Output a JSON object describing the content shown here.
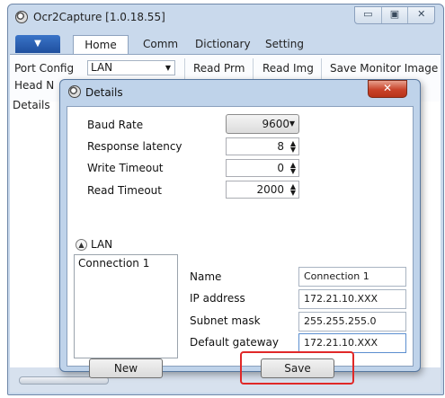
{
  "window": {
    "title": "Ocr2Capture [1.0.18.55]",
    "controls": [
      "▭",
      "▣",
      "✕"
    ]
  },
  "ribbon": {
    "tabs": [
      "Home",
      "Comm",
      "Dictionary",
      "Setting"
    ],
    "row1": {
      "port_config_label": "Port Config",
      "port_config_value": "LAN",
      "read_prm": "Read Prm",
      "read_img": "Read Img",
      "save_monitor_image": "Save Monitor Image"
    },
    "row2_label": "Head N",
    "row3_label": "Details"
  },
  "dialog": {
    "title": "Details",
    "close_label": "✕",
    "baud_rate": {
      "label": "Baud Rate",
      "value": "9600"
    },
    "response_latency": {
      "label": "Response latency",
      "value": "8"
    },
    "write_timeout": {
      "label": "Write Timeout",
      "value": "0"
    },
    "read_timeout": {
      "label": "Read Timeout",
      "value": "2000"
    },
    "lan_section_label": "LAN",
    "connections": [
      "Connection 1"
    ],
    "fields": {
      "name": {
        "label": "Name",
        "value": "Connection 1"
      },
      "ip": {
        "label": "IP address",
        "value": "172.21.10.XXX"
      },
      "subnet": {
        "label": "Subnet mask",
        "value": "255.255.255.0"
      },
      "gateway": {
        "label": "Default gateway",
        "value": "172.21.10.XXX"
      }
    },
    "new_button": "New",
    "save_button": "Save"
  },
  "colors": {
    "highlight": "#e02828",
    "app_menu": "#2a5fb0",
    "dialog_close": "#c9432a"
  }
}
